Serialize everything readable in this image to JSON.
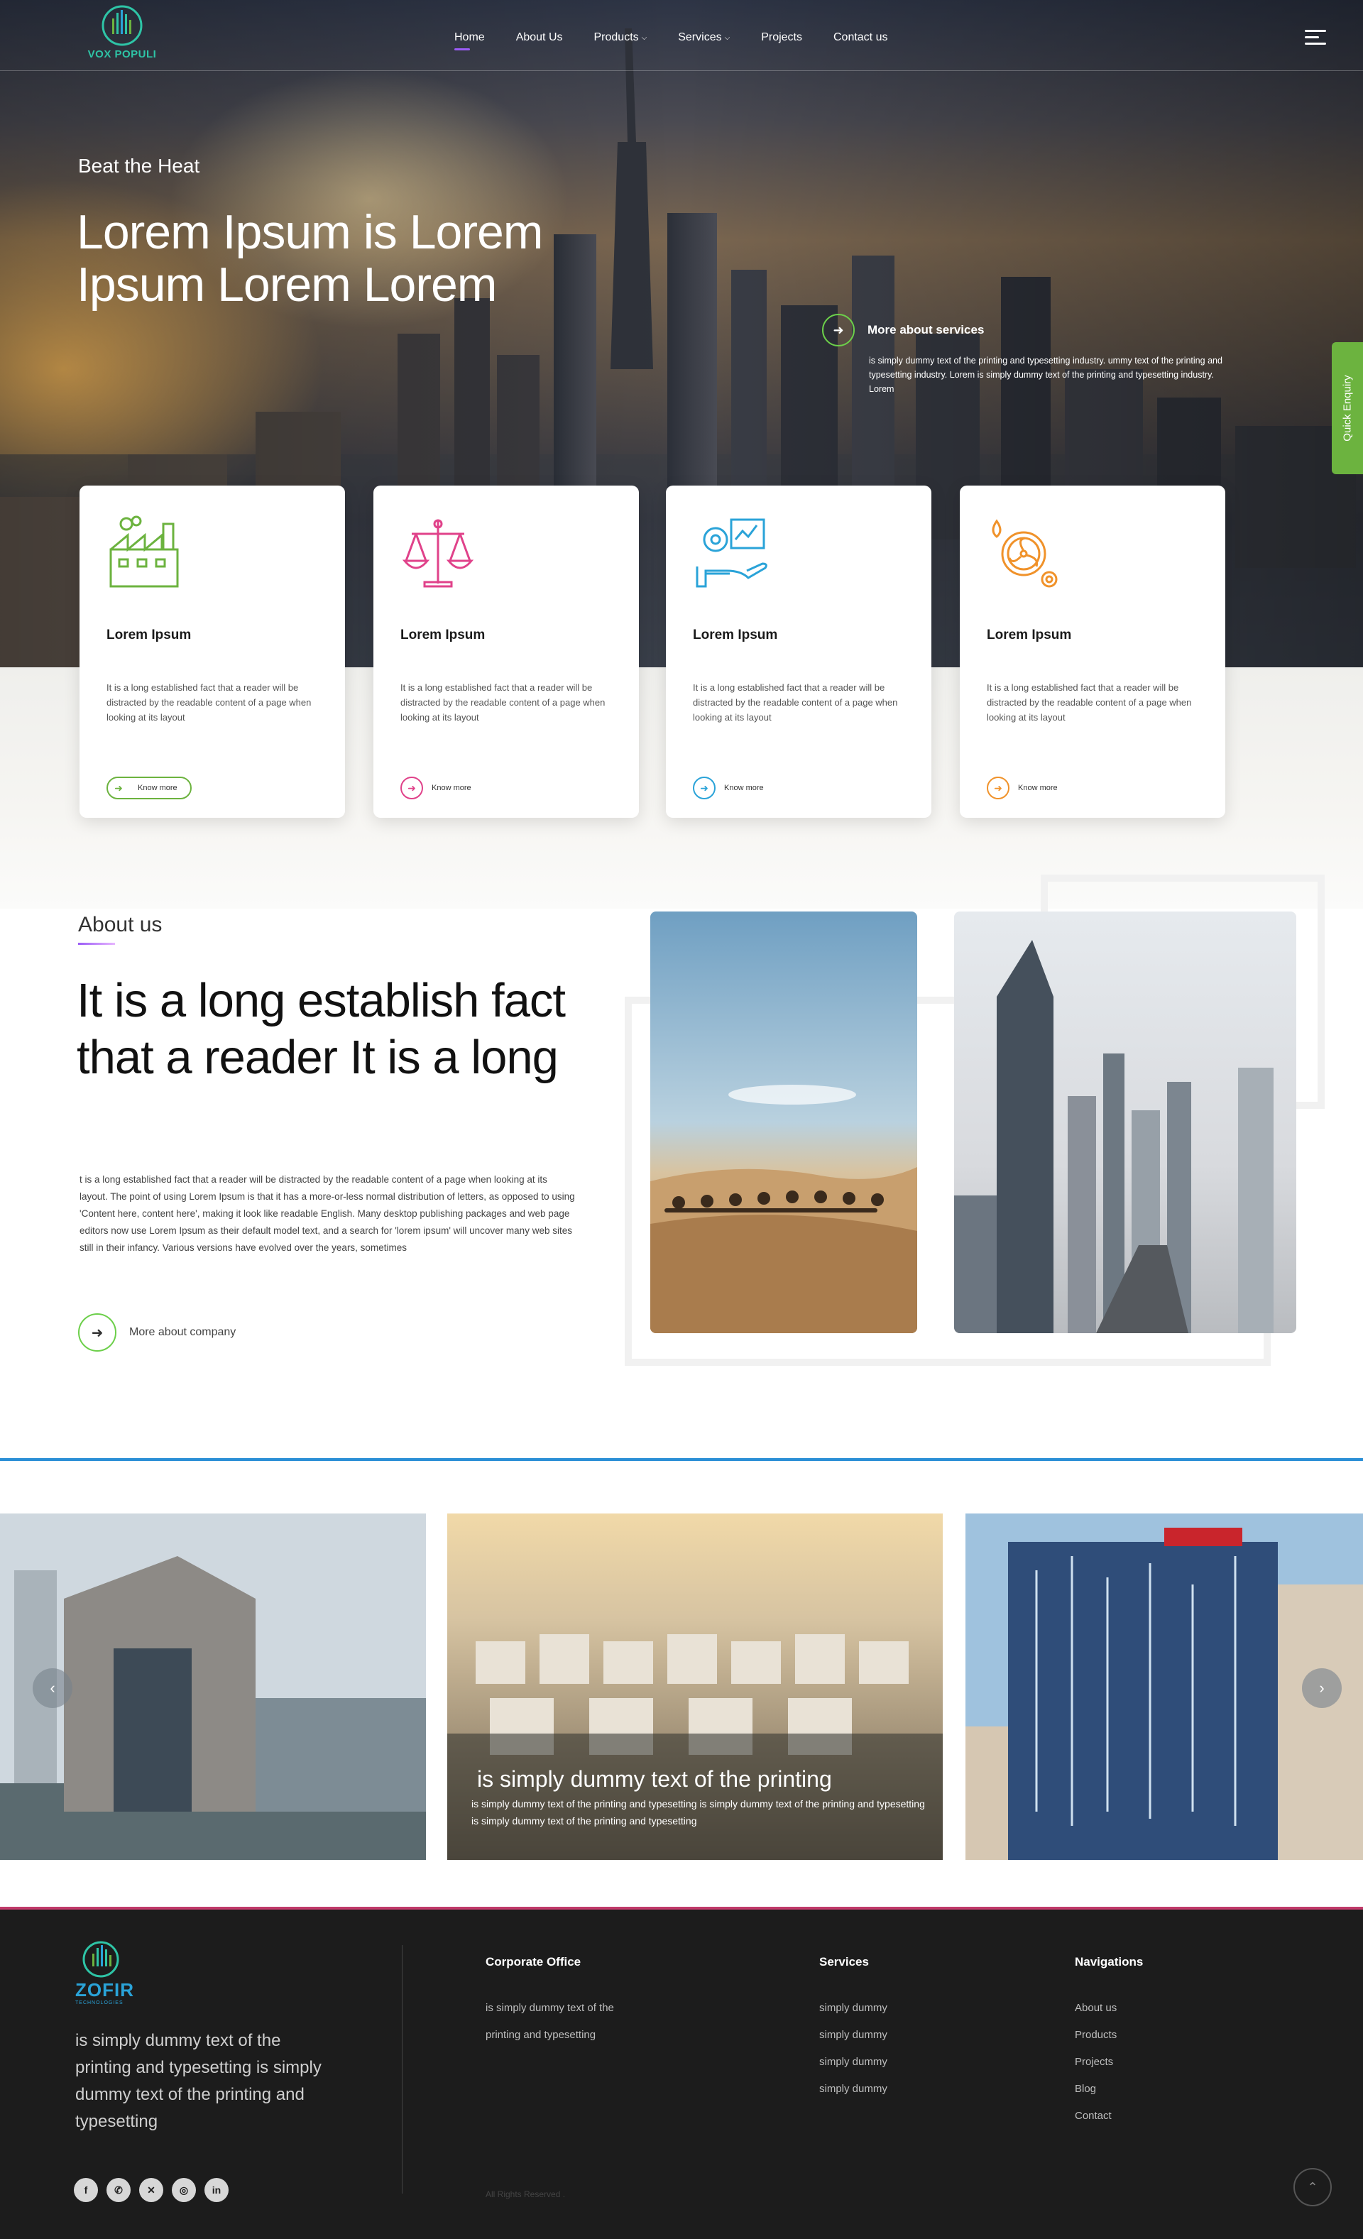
{
  "brand": {
    "name": "VOX POPULI",
    "accent": "#9b5cf6",
    "green": "#6cb33f"
  },
  "nav": {
    "items": [
      {
        "label": "Home"
      },
      {
        "label": "About Us"
      },
      {
        "label": "Products",
        "caret": "⌵"
      },
      {
        "label": "Services",
        "caret": "⌵"
      },
      {
        "label": "Projects"
      },
      {
        "label": "Contact us"
      }
    ],
    "menu_icon": "hamburger-icon"
  },
  "hero": {
    "kicker": "Beat the Heat",
    "title": "Lorem Ipsum is Lorem Ipsum Lorem Lorem",
    "services_link": "More about services",
    "services_desc": "is simply dummy text of the printing and typesetting industry. ummy text of the printing and typesetting industry. Lorem is simply dummy text of the printing and typesetting industry. Lorem"
  },
  "quick_enquiry": "Quick Enquiry",
  "cards": [
    {
      "title": "Lorem Ipsum",
      "text": "It is a long established fact that a reader will be distracted by the readable content of a page when looking at its layout",
      "button": "Know more",
      "color": "#6cb33f",
      "icon": "factory-icon"
    },
    {
      "title": "Lorem Ipsum",
      "text": "It is a long established fact that a reader will be distracted by the readable content of a page when looking at its layout",
      "button": "Know more",
      "color": "#e0428a",
      "icon": "scales-icon"
    },
    {
      "title": "Lorem Ipsum",
      "text": "It is a long established fact that a reader will be distracted by the readable content of a page when looking at its layout",
      "button": "Know more",
      "color": "#2aa3d8",
      "icon": "hand-gear-icon"
    },
    {
      "title": "Lorem Ipsum",
      "text": "It is a long established fact that a reader will be distracted by the readable content of a page when looking at its layout",
      "button": "Know more",
      "color": "#f0922a",
      "icon": "fan-gear-icon"
    }
  ],
  "about": {
    "kicker": "About us",
    "title": "It is a long establish fact that a reader It is a long",
    "text": "t is a long established fact that a reader will be distracted by the readable content of a page when looking at its layout. The point of using Lorem Ipsum is that it has a more-or-less normal distribution of letters, as opposed to using 'Content here, content here', making it look like readable English. Many desktop publishing packages and web page editors now use Lorem Ipsum as their default model text, and a search for 'lorem ipsum' will uncover many web sites still in their infancy. Various versions have evolved over the years, sometimes",
    "link": "More about company"
  },
  "gallery": {
    "caption_title": "is simply dummy text of the printing",
    "caption_text": "is simply dummy text of the printing and typesetting  is simply dummy text of the printing and typesetting  is simply dummy text of the printing and typesetting",
    "prev_icon": "chevron-left-icon",
    "next_icon": "chevron-right-icon"
  },
  "footer": {
    "logo_text": "ZOFIR",
    "logo_sub": "TECHNOLOGIES",
    "description": "is simply dummy text of the printing and typesetting  is simply dummy text of the printing and typesetting",
    "corporate": {
      "heading": "Corporate Office",
      "lines": [
        " is simply dummy text of the",
        "printing and typesetting"
      ]
    },
    "services": {
      "heading": "Services",
      "items": [
        "simply dummy",
        "simply dummy",
        "simply dummy",
        "simply dummy"
      ]
    },
    "navigations": {
      "heading": "Navigations",
      "items": [
        "About us",
        "Products",
        "Projects",
        "Blog",
        "Contact"
      ]
    },
    "social": [
      "facebook-icon",
      "whatsapp-icon",
      "x-icon",
      "instagram-icon",
      "linkedin-icon"
    ],
    "rights": "All Rights Reserved ."
  }
}
